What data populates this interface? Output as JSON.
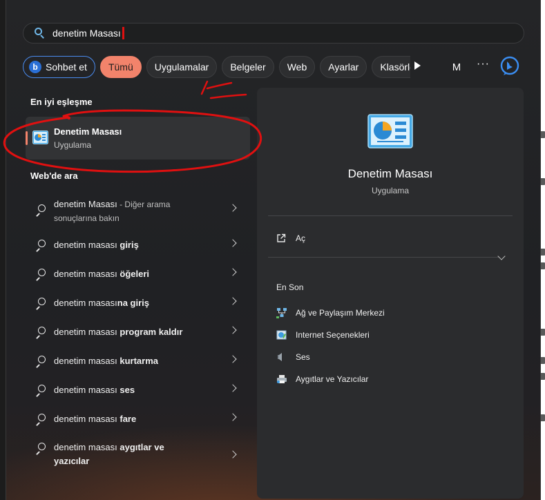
{
  "search": {
    "value": "denetim Masası"
  },
  "filters": {
    "chat_label": "Sohbet et",
    "chips": [
      "Tümü",
      "Uygulamalar",
      "Belgeler",
      "Web",
      "Ayarlar"
    ],
    "clipped_chip": "Klasörle",
    "active_chip": "Tümü",
    "avatar_letter": "M",
    "more_label": "···"
  },
  "best_match": {
    "section_title": "En iyi eşleşme",
    "name": "Denetim Masası",
    "type": "Uygulama"
  },
  "web_search": {
    "section_title": "Web'de ara",
    "items": [
      {
        "prefix": "denetim Masası",
        "bold": "",
        "suffix": " - Diğer arama",
        "line2": "sonuçlarına bakın"
      },
      {
        "prefix": "denetim masası ",
        "bold": "giriş",
        "suffix": "",
        "line2": ""
      },
      {
        "prefix": "denetim masası ",
        "bold": "öğeleri",
        "suffix": "",
        "line2": ""
      },
      {
        "prefix": "denetim masası",
        "bold": "na giriş",
        "suffix": "",
        "line2": ""
      },
      {
        "prefix": "denetim masası ",
        "bold": "program kaldır",
        "suffix": "",
        "line2": ""
      },
      {
        "prefix": "denetim masası ",
        "bold": "kurtarma",
        "suffix": "",
        "line2": ""
      },
      {
        "prefix": "denetim masası ",
        "bold": "ses",
        "suffix": "",
        "line2": ""
      },
      {
        "prefix": "denetim masası ",
        "bold": "fare",
        "suffix": "",
        "line2": ""
      },
      {
        "prefix": "denetim masası ",
        "bold": "aygıtlar ve",
        "suffix": "",
        "line2": "yazıcılar"
      }
    ]
  },
  "detail": {
    "title": "Denetim Masası",
    "subtitle": "Uygulama",
    "open_label": "Aç",
    "recent_title": "En Son",
    "recent": [
      {
        "label": "Ağ ve Paylaşım Merkezi",
        "icon": "network-icon"
      },
      {
        "label": "Internet Seçenekleri",
        "icon": "internet-options-icon"
      },
      {
        "label": "Ses",
        "icon": "speaker-icon"
      },
      {
        "label": "Aygıtlar ve Yazıcılar",
        "icon": "printer-icon"
      }
    ]
  },
  "colors": {
    "accent": "#f2836b",
    "annotation": "#e01010",
    "bing_blue": "#2a6fd6"
  }
}
